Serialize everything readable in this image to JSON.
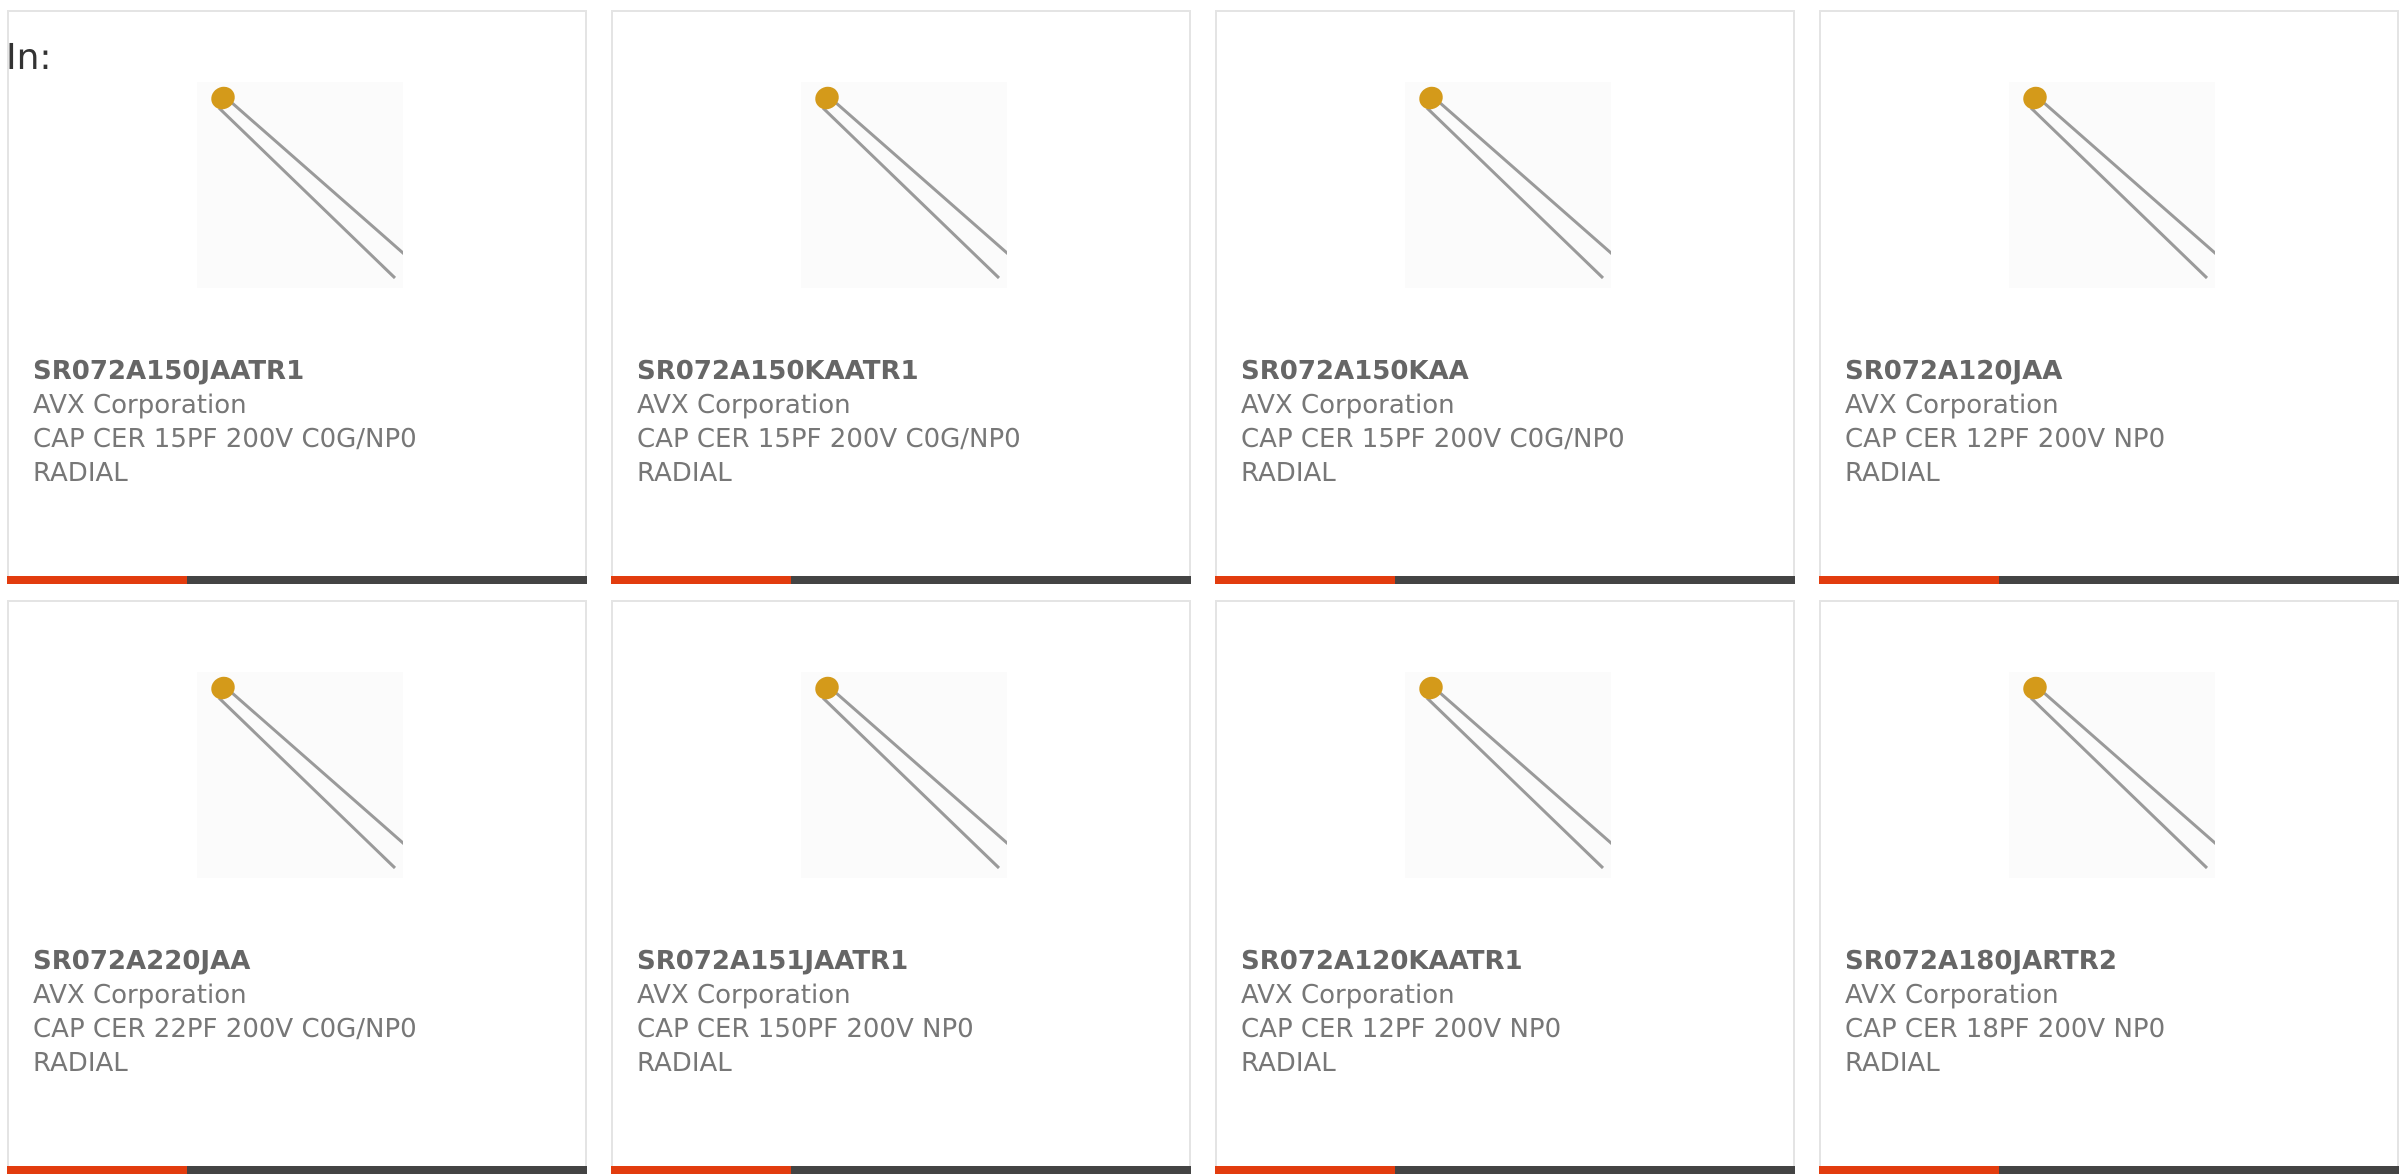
{
  "header": {
    "in_label": "In:"
  },
  "colors": {
    "accent": "#e23c0e",
    "bar_dark": "#444444",
    "card_border": "#e4e4e4",
    "capacitor_body": "#d49a1a",
    "lead_wire": "#9a9a9a"
  },
  "accent_progress": 0.31,
  "products": [
    {
      "part_number": "SR072A150JAATR1",
      "manufacturer": "AVX Corporation",
      "description": "CAP CER 15PF 200V C0G/NP0 RADIAL",
      "image_icon": "radial-capacitor-icon"
    },
    {
      "part_number": "SR072A150KAATR1",
      "manufacturer": "AVX Corporation",
      "description": "CAP CER 15PF 200V C0G/NP0 RADIAL",
      "image_icon": "radial-capacitor-icon"
    },
    {
      "part_number": "SR072A150KAA",
      "manufacturer": "AVX Corporation",
      "description": "CAP CER 15PF 200V C0G/NP0 RADIAL",
      "image_icon": "radial-capacitor-icon"
    },
    {
      "part_number": "SR072A120JAA",
      "manufacturer": "AVX Corporation",
      "description": "CAP CER 12PF 200V NP0 RADIAL",
      "image_icon": "radial-capacitor-icon"
    },
    {
      "part_number": "SR072A220JAA",
      "manufacturer": "AVX Corporation",
      "description": "CAP CER 22PF 200V C0G/NP0 RADIAL",
      "image_icon": "radial-capacitor-icon"
    },
    {
      "part_number": "SR072A151JAATR1",
      "manufacturer": "AVX Corporation",
      "description": "CAP CER 150PF 200V NP0 RADIAL",
      "image_icon": "radial-capacitor-icon"
    },
    {
      "part_number": "SR072A120KAATR1",
      "manufacturer": "AVX Corporation",
      "description": "CAP CER 12PF 200V NP0 RADIAL",
      "image_icon": "radial-capacitor-icon"
    },
    {
      "part_number": "SR072A180JARTR2",
      "manufacturer": "AVX Corporation",
      "description": "CAP CER 18PF 200V NP0 RADIAL",
      "image_icon": "radial-capacitor-icon"
    }
  ]
}
